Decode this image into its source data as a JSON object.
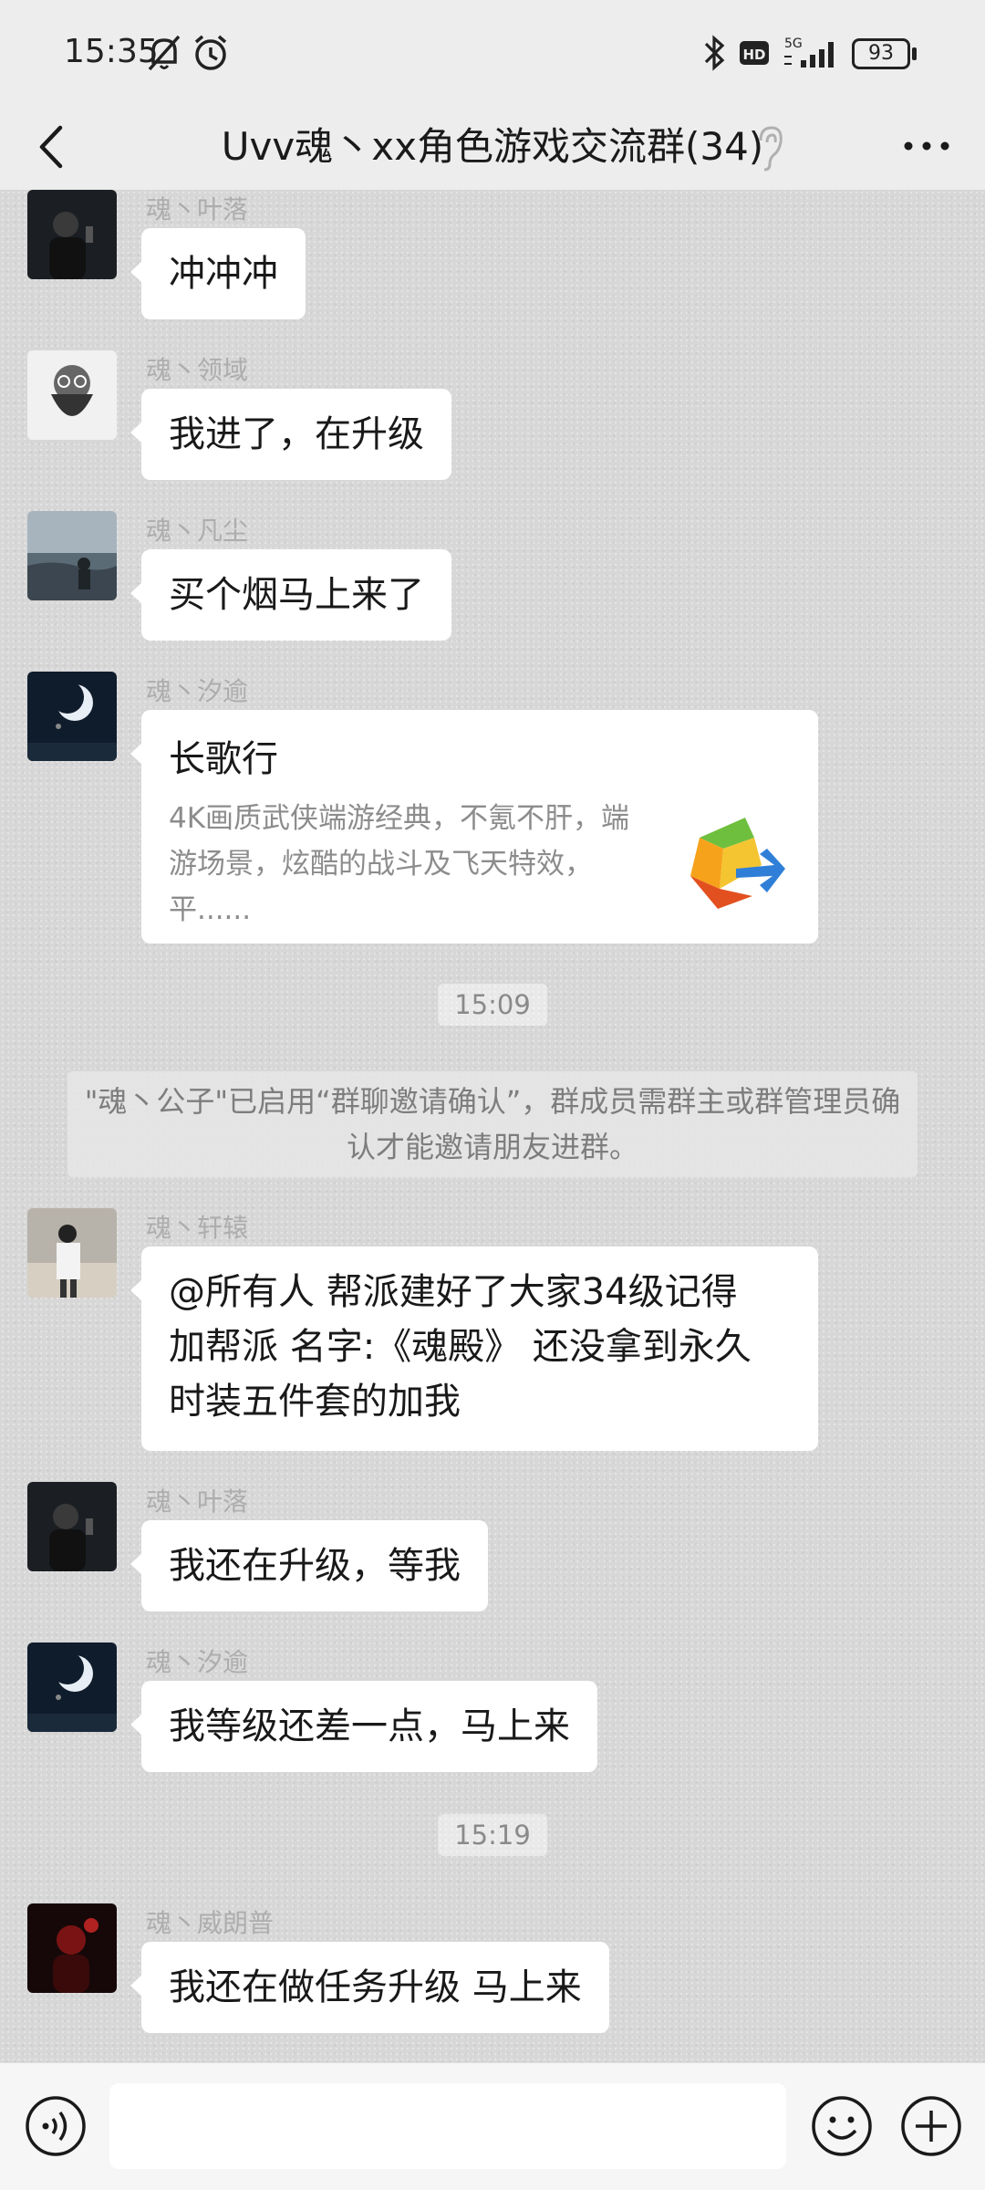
{
  "status_bar": {
    "time": "15:35",
    "network": "5G",
    "hd": "HD",
    "battery": "93"
  },
  "header": {
    "title": "Uvv魂丶xx角色游戏交流群(34)"
  },
  "messages": [
    {
      "sender": "魂丶叶落",
      "text": "冲冲冲",
      "avatar": "dark-portrait-with-phone"
    },
    {
      "sender": "魂丶领域",
      "text": "我进了，在升级",
      "avatar": "bearded-glasses-cartoon"
    },
    {
      "sender": "魂丶凡尘",
      "text": "买个烟马上来了",
      "avatar": "seaside-silhouette"
    },
    {
      "sender": "魂丶汐逾",
      "avatar": "crescent-moon-night",
      "card": {
        "title": "长歌行",
        "description": "4K画质武侠端游经典，不氪不肝，端游场景，炫酷的战斗及飞天特效，平......",
        "icon": "tencent-games-logo-icon"
      }
    },
    {
      "sender": "魂丶轩辕",
      "avatar": "man-on-beach",
      "lines": [
        "@所有人  帮派建好了大家34级记得",
        "加帮派 名字:《魂殿》  还没拿到永久",
        "时装五件套的加我"
      ]
    },
    {
      "sender": "魂丶叶落",
      "text": "我还在升级，等我",
      "avatar": "dark-portrait-with-phone"
    },
    {
      "sender": "魂丶汐逾",
      "text": "我等级还差一点，马上来",
      "avatar": "crescent-moon-night"
    },
    {
      "sender": "魂丶威朗普",
      "text": "我还在做任务升级 马上来",
      "avatar": "red-lit-portrait"
    }
  ],
  "timestamps": [
    "15:09",
    "15:19"
  ],
  "system_message": "\"魂丶公子\"已启用“群聊邀请确认”，群成员需群主或群管理员确认才能邀请朋友进群。",
  "colors": {
    "chat_background": "#d7d7d7",
    "bubble": "#ffffff",
    "text": "#191919",
    "sender_name": "#adadad"
  }
}
